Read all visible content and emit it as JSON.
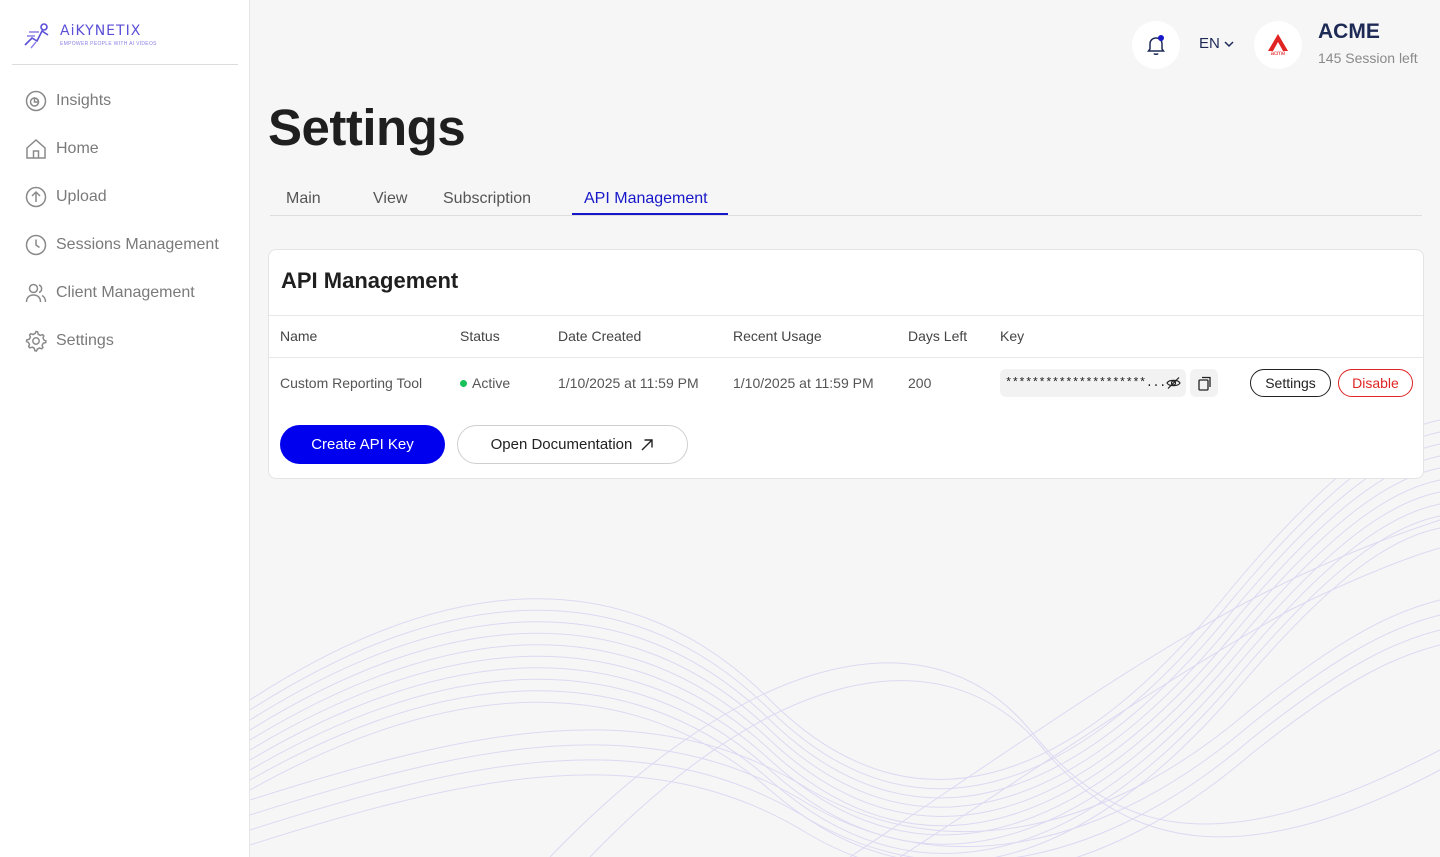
{
  "brand": {
    "name": "AiKYNETIX",
    "tagline": "EMPOWER PEOPLE WITH AI VIDEOS",
    "accent": "#5b4fd6"
  },
  "sidebar": {
    "items": [
      {
        "label": "Insights",
        "icon": "insights-icon"
      },
      {
        "label": "Home",
        "icon": "home-icon"
      },
      {
        "label": "Upload",
        "icon": "upload-icon"
      },
      {
        "label": "Sessions Management",
        "icon": "clock-icon"
      },
      {
        "label": "Client Management",
        "icon": "users-icon"
      },
      {
        "label": "Settings",
        "icon": "gear-icon"
      }
    ]
  },
  "header": {
    "language": "EN",
    "company_name": "ACME",
    "company_logo_text": "acme",
    "sessions_left": "145 Session left"
  },
  "page": {
    "title": "Settings",
    "tabs": [
      {
        "label": "Main",
        "active": false
      },
      {
        "label": "View",
        "active": false
      },
      {
        "label": "Subscription",
        "active": false
      },
      {
        "label": "API Management",
        "active": true
      }
    ]
  },
  "api": {
    "title": "API Management",
    "columns": [
      "Name",
      "Status",
      "Date Created",
      "Recent Usage",
      "Days Left",
      "Key"
    ],
    "rows": [
      {
        "name": "Custom Reporting Tool",
        "status": "Active",
        "date_created": "1/10/2025 at 11:59 PM",
        "recent_usage": "1/10/2025 at 11:59 PM",
        "days_left": "200",
        "key": "*********************...",
        "settings_label": "Settings",
        "disable_label": "Disable"
      }
    ],
    "create_label": "Create API Key",
    "docs_label": "Open Documentation"
  },
  "colors": {
    "primary": "#0000ee",
    "tab_active": "#1717c9",
    "danger": "#e02424",
    "status_active": "#18c05a"
  }
}
